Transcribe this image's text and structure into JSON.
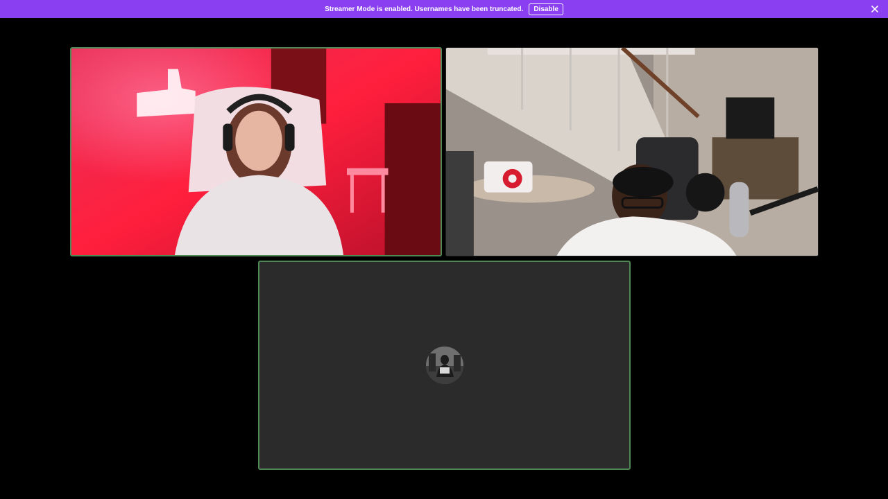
{
  "banner": {
    "message": "Streamer Mode is enabled. Usernames have been truncated.",
    "disable_label": "Disable",
    "close_icon": "close-icon",
    "background": "#8a3ff0"
  },
  "call": {
    "participants": [
      {
        "id": "participant-1",
        "video": "on",
        "speaking": true,
        "scene": "red-lit room, gaming chair, neon sign, headset"
      },
      {
        "id": "participant-2",
        "video": "on",
        "speaking": false,
        "scene": "living room, staircase, microphone, glasses"
      },
      {
        "id": "participant-3",
        "video": "off",
        "speaking": true,
        "avatar_icon": "user-avatar"
      }
    ],
    "speaking_border_color": "#4f8a55",
    "empty_tile_color": "#2b2b2b"
  }
}
